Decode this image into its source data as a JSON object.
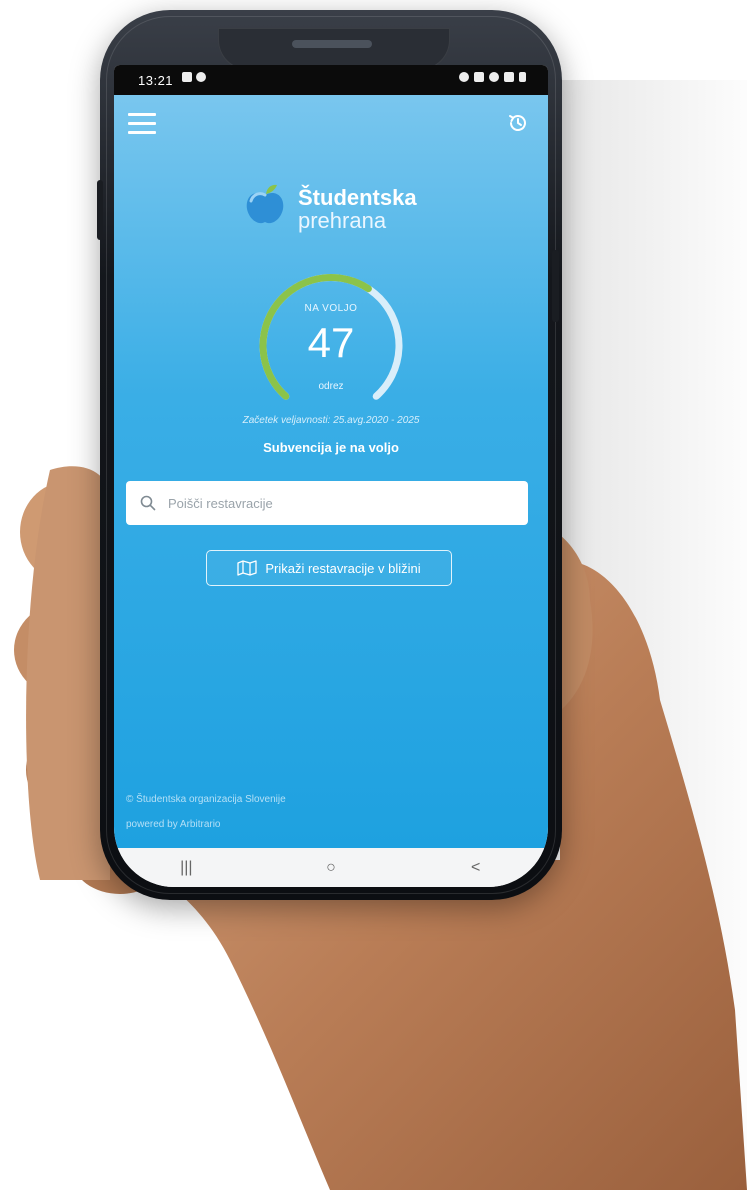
{
  "status_bar": {
    "time": "13:21"
  },
  "app": {
    "logo": {
      "line1": "Študentska",
      "line2": "prehrana"
    },
    "gauge": {
      "top_label": "NA VOLJO",
      "value": "47",
      "unit": "odrez",
      "fraction": 0.62
    },
    "valid_until": "Začetek veljavnosti: 25.avg.2020 - 2025",
    "subsidy_status": "Subvencija je na voljo",
    "search": {
      "placeholder": "Poišči restavracije"
    },
    "nearby_button": "Prikaži restavracije v bližini",
    "footer": {
      "line1": "© Študentska organizacija Slovenije",
      "line2": "powered by Arbitrario"
    }
  },
  "nav": {
    "recents": "|||",
    "home": "○",
    "back": "<"
  },
  "colors": {
    "screen_top": "#79c6ee",
    "screen_bottom": "#1ea1e0",
    "gauge_green": "#8bc34a",
    "gauge_track": "#d9eefa"
  }
}
